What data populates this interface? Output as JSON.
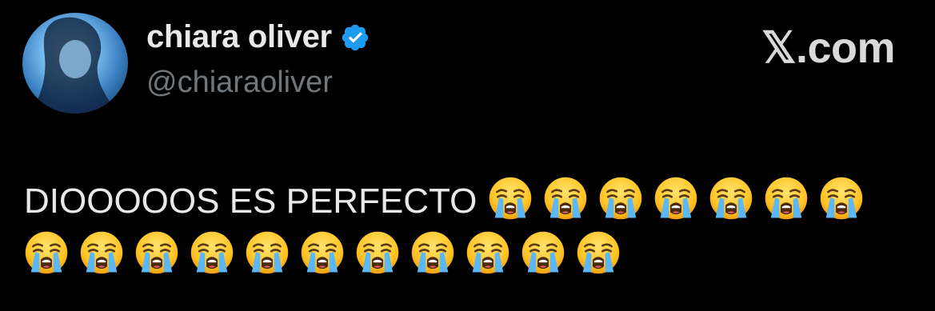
{
  "profile": {
    "display_name": "chiara oliver",
    "handle": "@chiaraoliver",
    "verified": true,
    "verified_icon": "verified-badge-icon",
    "avatar_icon": "profile-avatar"
  },
  "brand": {
    "label": "𝕏.com"
  },
  "tweet": {
    "text": "DIOOOOOS ES PERFECTO",
    "emoji": "😭",
    "emoji_name": "loudly-crying-face-icon",
    "emoji_count_line1": 7,
    "emoji_count_line2": 11
  },
  "colors": {
    "background": "#000000",
    "text": "#e7e9ea",
    "secondary": "#71767b",
    "verified_blue": "#1d9bf0"
  }
}
